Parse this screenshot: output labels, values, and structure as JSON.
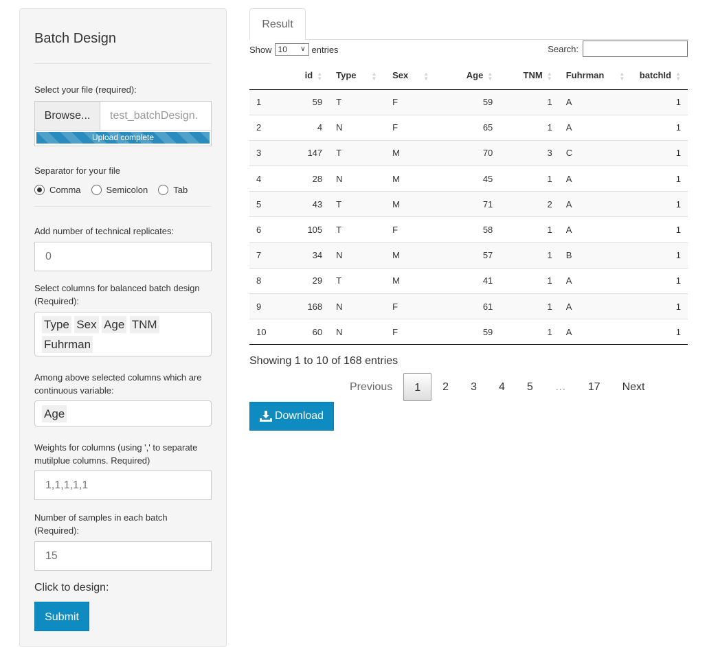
{
  "sidebar": {
    "title": "Batch Design",
    "file_label": "Select your file (required):",
    "browse_label": "Browse...",
    "file_name": "test_batchDesign.",
    "upload_status": "Upload complete",
    "separator_label": "Separator for your file",
    "separator_options": [
      "Comma",
      "Semicolon",
      "Tab"
    ],
    "separator_selected": "Comma",
    "replicates_label": "Add number of technical replicates:",
    "replicates_value": "0",
    "columns_label_line1": "Select columns for balanced batch design",
    "columns_label_line2": "(Required):",
    "columns_selected": [
      "Type",
      "Sex",
      "Age",
      "TNM",
      "Fuhrman"
    ],
    "continuous_label_line1": "Among above selected columns which are",
    "continuous_label_line2": "continuous variable:",
    "continuous_selected": [
      "Age"
    ],
    "weights_label_line1": "Weights for columns (using ',' to separate",
    "weights_label_line2": "mutilplue columns. Required)",
    "weights_value": "1,1,1,1,1",
    "samples_label_line1": "Number of samples in each batch",
    "samples_label_line2": "(Required):",
    "samples_value": "15",
    "design_label": "Click to design:",
    "submit_label": "Submit"
  },
  "main": {
    "tab_label": "Result",
    "show_label": "Show",
    "entries_label": "entries",
    "page_length": "10",
    "search_label": "Search:",
    "search_value": "",
    "table": {
      "columns": [
        "",
        "id",
        "Type",
        "Sex",
        "Age",
        "TNM",
        "Fuhrman",
        "batchId"
      ],
      "rows": [
        [
          "1",
          "59",
          "T",
          "F",
          "59",
          "1",
          "A",
          "1"
        ],
        [
          "2",
          "4",
          "N",
          "F",
          "65",
          "1",
          "A",
          "1"
        ],
        [
          "3",
          "147",
          "T",
          "M",
          "70",
          "3",
          "C",
          "1"
        ],
        [
          "4",
          "28",
          "N",
          "M",
          "45",
          "1",
          "A",
          "1"
        ],
        [
          "5",
          "43",
          "T",
          "M",
          "71",
          "2",
          "A",
          "1"
        ],
        [
          "6",
          "105",
          "T",
          "F",
          "58",
          "1",
          "A",
          "1"
        ],
        [
          "7",
          "34",
          "N",
          "M",
          "57",
          "1",
          "B",
          "1"
        ],
        [
          "8",
          "29",
          "T",
          "M",
          "41",
          "1",
          "A",
          "1"
        ],
        [
          "9",
          "168",
          "N",
          "F",
          "61",
          "1",
          "A",
          "1"
        ],
        [
          "10",
          "60",
          "N",
          "F",
          "59",
          "1",
          "A",
          "1"
        ]
      ]
    },
    "info_text": "Showing 1 to 10 of 168 entries",
    "pagination": {
      "previous": "Previous",
      "pages": [
        "1",
        "2",
        "3",
        "4",
        "5",
        "…",
        "17"
      ],
      "current": "1",
      "next": "Next"
    },
    "download_label": "Download",
    "accent_color": "#0e8cc2"
  }
}
